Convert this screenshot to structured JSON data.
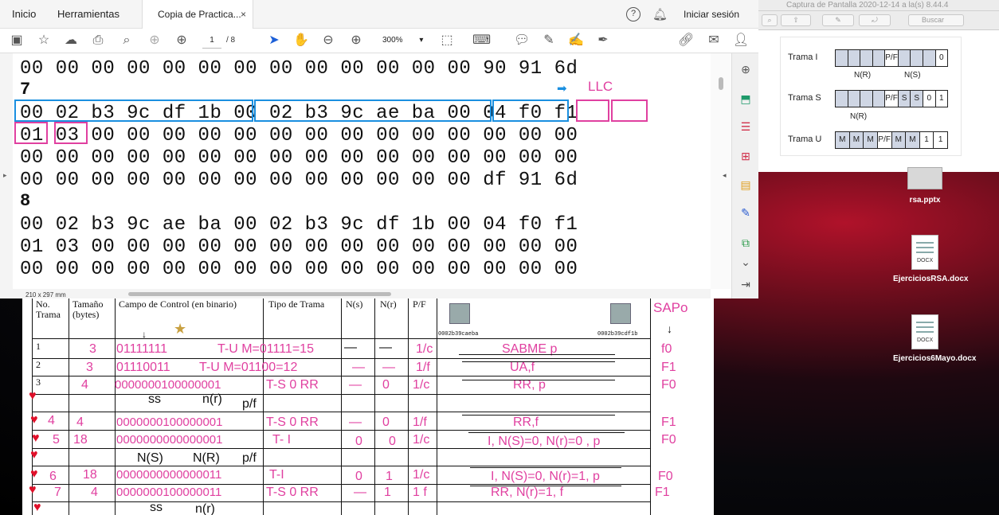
{
  "viewer": {
    "title": "Captura de Pantalla 2020-12-14 a la(s) 8.44.4",
    "search_placeholder": "Buscar",
    "frames": [
      {
        "label": "Trama I",
        "cells": [
          "",
          "",
          "",
          "",
          "P/F",
          "",
          "",
          "",
          "0"
        ],
        "sub": [
          "N(R)",
          "N(S)"
        ]
      },
      {
        "label": "Trama S",
        "cells": [
          "",
          "",
          "",
          "",
          "P/F",
          "S",
          "S",
          "0",
          "1"
        ],
        "sub": [
          "N(R)"
        ]
      },
      {
        "label": "Trama U",
        "cells": [
          "M",
          "M",
          "M",
          "P/F",
          "M",
          "M",
          "1",
          "1"
        ],
        "sub": []
      }
    ]
  },
  "desktop": {
    "icons": [
      {
        "name": "rsa.pptx"
      },
      {
        "name": "EjerciciosRSA.docx"
      },
      {
        "name": "Ejercicios6Mayo.docx"
      }
    ]
  },
  "acrobat": {
    "tabs": {
      "home": "Inicio",
      "tools": "Herramientas",
      "doc": "Copia de Practica...",
      "close": "×"
    },
    "signin": "Iniciar sesión",
    "page_current": "1",
    "page_total": "/ 8",
    "zoom": "300%",
    "page_size": "210 x 297 mm",
    "hex_lines": [
      "00 00 00 00 00 00 00 00 00 00 00 00 00 90 91 6d",
      "00 02 b3 9c df 1b 00 02 b3 9c ae ba 00 04 f0 f1",
      "01 03 00 00 00 00 00 00 00 00 00 00 00 00 00 00",
      "00 00 00 00 00 00 00 00 00 00 00 00 00 00 00 00",
      "00 00 00 00 00 00 00 00 00 00 00 00 00 df 91 6d",
      "00 02 b3 9c ae ba 00 02 b3 9c df 1b 00 04 f0 f1",
      "01 03 00 00 00 00 00 00 00 00 00 00 00 00 00 00",
      "00 00 00 00 00 00 00 00 00 00 00 00 00 00 00 00"
    ],
    "frame_numbers": [
      "7",
      "8"
    ],
    "llc": "LLC"
  },
  "paper": {
    "headers": [
      "No. Trama",
      "Tamaño (bytes)",
      "Campo de Control (en binario)",
      "Tipo de Trama",
      "N(s)",
      "N(r)",
      "P/F",
      "SAPo"
    ],
    "mac_left": "0002b39caeba",
    "mac_right": "0002b39cdf1b",
    "rows": [
      {
        "num": "1",
        "size": "3",
        "ctrl": "01111111",
        "type": "T-U M=01111=15",
        "ns": "—",
        "nr": "—",
        "pf": "1/c",
        "desc": "SABME p",
        "sap": "f0"
      },
      {
        "num": "2",
        "size": "3",
        "ctrl": "01110011",
        "type": "T-U  M=01100=12",
        "ns": "—",
        "nr": "—",
        "pf": "1/f",
        "desc": "UA,f",
        "sap": "F1"
      },
      {
        "num": "3",
        "size": "4",
        "ctrl": "0000000100000001",
        "type": "T-S 0  RR",
        "ns": "—",
        "nr": "0",
        "pf": "1/c",
        "desc": "RR, p",
        "sap": "F0"
      },
      {
        "num": "4",
        "size": "4",
        "ctrl": "0000000100000001",
        "type": "T-S 0   RR",
        "ns": "—",
        "nr": "0",
        "pf": "1/f",
        "desc": "RR,f",
        "sap": "F1"
      },
      {
        "num": "5",
        "size": "18",
        "ctrl": "0000000000000001",
        "type": "T- I",
        "ns": "0",
        "nr": "0",
        "pf": "1/c",
        "desc": "I, N(S)=0, N(r)=0 , p",
        "sap": "F0"
      },
      {
        "num": "6",
        "size": "18",
        "ctrl": "0000000000000011",
        "type": "T-I",
        "ns": "0",
        "nr": "1",
        "pf": "1/c",
        "desc": "I, N(S)=0, N(r)=1, p",
        "sap": "F0"
      },
      {
        "num": "7",
        "size": "4",
        "ctrl": "0000000100000011",
        "type": "T-S 0 RR",
        "ns": "—",
        "nr": "1",
        "pf": "1 f",
        "desc": "RR, N(r)=1, f",
        "sap": "F1"
      }
    ],
    "notes": {
      "ss": "ss",
      "nr": "n(r)",
      "pf": "p/f",
      "NS": "N(S)",
      "NR": "N(R)"
    }
  }
}
